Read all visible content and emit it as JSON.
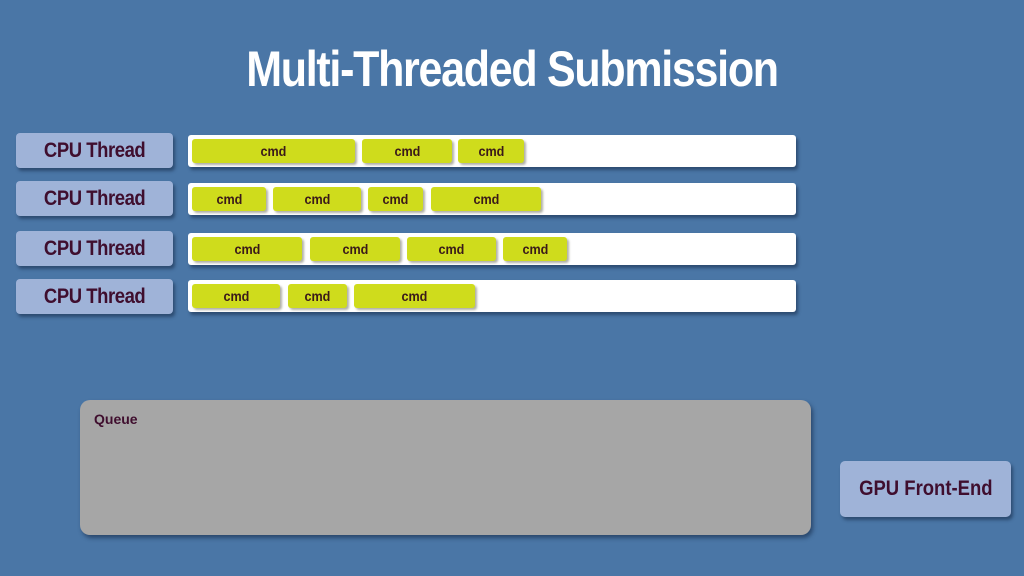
{
  "title": "Multi-Threaded Submission",
  "threads": [
    {
      "label": "CPU Thread",
      "cmds": [
        "cmd",
        "cmd",
        "cmd"
      ]
    },
    {
      "label": "CPU Thread",
      "cmds": [
        "cmd",
        "cmd",
        "cmd",
        "cmd"
      ]
    },
    {
      "label": "CPU Thread",
      "cmds": [
        "cmd",
        "cmd",
        "cmd",
        "cmd"
      ]
    },
    {
      "label": "CPU Thread",
      "cmds": [
        "cmd",
        "cmd",
        "cmd"
      ]
    }
  ],
  "queue": {
    "label": "Queue"
  },
  "gpu": {
    "label": "GPU Front-End"
  },
  "colors": {
    "background": "#4a76a6",
    "label_box": "#9fb3d8",
    "cmd": "#cfdc1c",
    "queue": "#a6a6a6",
    "text_dark": "#3f0e2e"
  }
}
